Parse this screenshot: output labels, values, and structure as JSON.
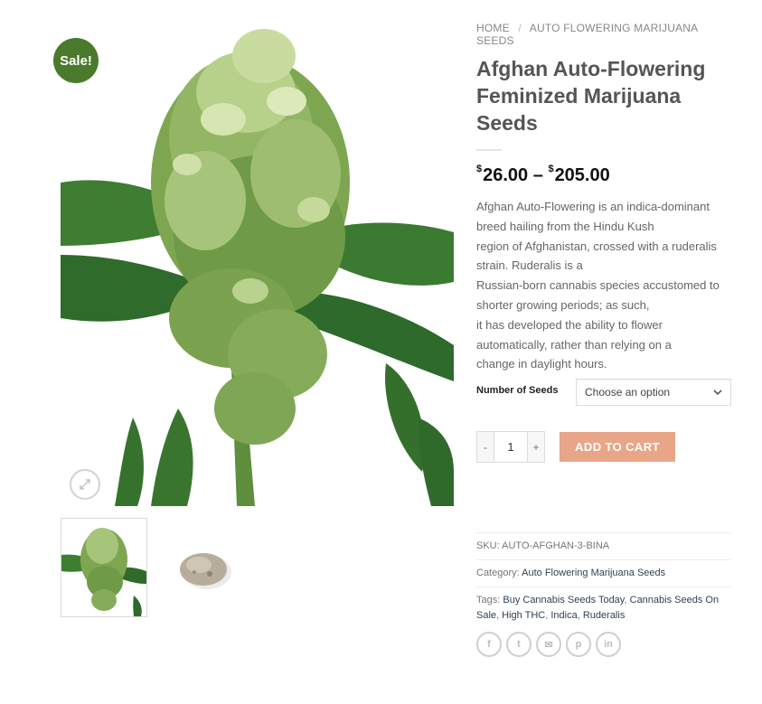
{
  "badge": {
    "sale": "Sale!"
  },
  "breadcrumb": {
    "home": "HOME",
    "separator": "/",
    "category": "AUTO FLOWERING MARIJUANA SEEDS"
  },
  "product": {
    "title_lines": [
      "Afghan Auto-Flowering",
      "Feminized Marijuana",
      "Seeds"
    ],
    "price": {
      "currency": "$",
      "min": "26.00",
      "dash": "–",
      "max": "205.00"
    },
    "description_lines": [
      "Afghan Auto-Flowering is an indica-dominant",
      "breed hailing from the Hindu Kush",
      "region of Afghanistan, crossed with a ruderalis",
      "strain. Ruderalis is a",
      "Russian-born cannabis species accustomed to",
      "shorter growing periods; as such,",
      "it has developed the ability to flower",
      "automatically, rather than relying on a",
      "change in daylight hours."
    ]
  },
  "variation": {
    "label": "Number of Seeds",
    "selected": "Choose an option"
  },
  "cart": {
    "minus": "-",
    "quantity": "1",
    "plus": "+",
    "add_label": "ADD TO CART"
  },
  "meta": {
    "sku_label": "SKU:",
    "sku": "AUTO-AFGHAN-3-BINA",
    "category_label": "Category:",
    "category": "Auto Flowering Marijuana Seeds",
    "tags_label": "Tags:",
    "tags": [
      "Buy Cannabis Seeds Today",
      "Cannabis Seeds On Sale",
      "High THC",
      "Indica",
      "Ruderalis"
    ]
  },
  "share": {
    "icons": [
      "facebook-icon",
      "twitter-icon",
      "email-icon",
      "pinterest-icon",
      "linkedin-icon"
    ],
    "glyphs": [
      "f",
      "t",
      "✉",
      "p",
      "in"
    ]
  },
  "colors": {
    "sale_badge": "#4a7a2c",
    "add_to_cart": "#e9a588",
    "title": "#555555",
    "link": "#334155"
  }
}
